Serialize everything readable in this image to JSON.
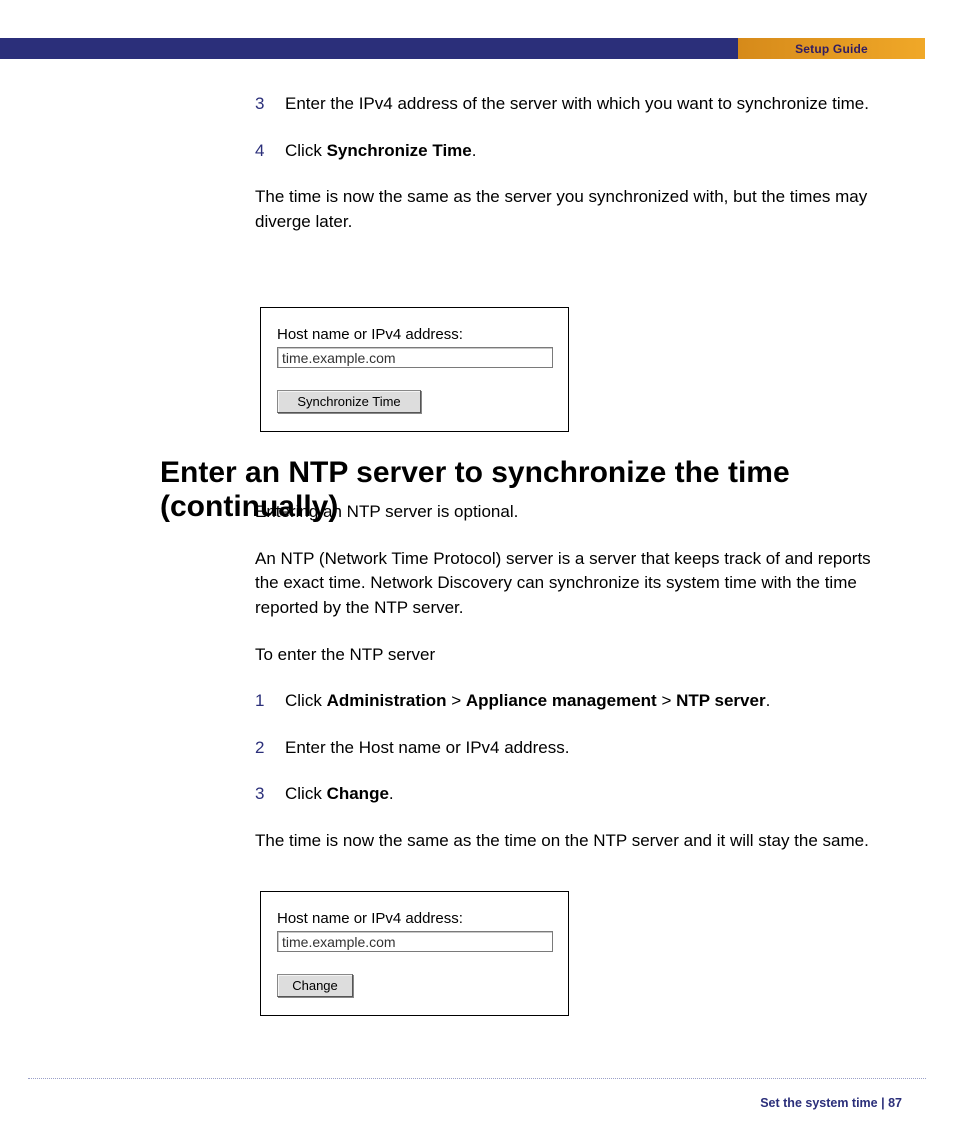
{
  "header": {
    "title": "Setup Guide"
  },
  "section1": {
    "steps": [
      {
        "num": "3",
        "text": "Enter the IPv4 address of the server with which you want to synchronize time."
      },
      {
        "num": "4",
        "prefix": "Click ",
        "bold": "Synchronize Time",
        "suffix": "."
      }
    ],
    "after": "The time is now the same as the server you synchronized with, but the times may diverge later."
  },
  "shot1": {
    "label": "Host name or IPv4 address:",
    "value": "time.example.com",
    "button": "Synchronize Time"
  },
  "heading": "Enter an NTP server to synchronize the time (continually)",
  "section2": {
    "p1": "Entering an NTP server is optional.",
    "p2": "An NTP (Network Time Protocol) server is a server that keeps track of and reports the exact time. Network Discovery can synchronize its system time with the time reported by the NTP server.",
    "p3": "To enter the NTP server",
    "steps": [
      {
        "num": "1",
        "prefix": "Click ",
        "b1": "Administration",
        "sep1": " > ",
        "b2": "Appliance management",
        "sep2": " > ",
        "b3": "NTP server",
        "suffix": "."
      },
      {
        "num": "2",
        "text": "Enter the Host name or IPv4 address."
      },
      {
        "num": "3",
        "prefix": "Click ",
        "bold": "Change",
        "suffix": "."
      }
    ],
    "after": "The time is now the same as the time on the NTP server and it will stay the same."
  },
  "shot2": {
    "label": "Host name or IPv4 address:",
    "value": "time.example.com",
    "button": "Change"
  },
  "footer": {
    "section": "Set the system time",
    "sep": " | ",
    "page": "87"
  }
}
